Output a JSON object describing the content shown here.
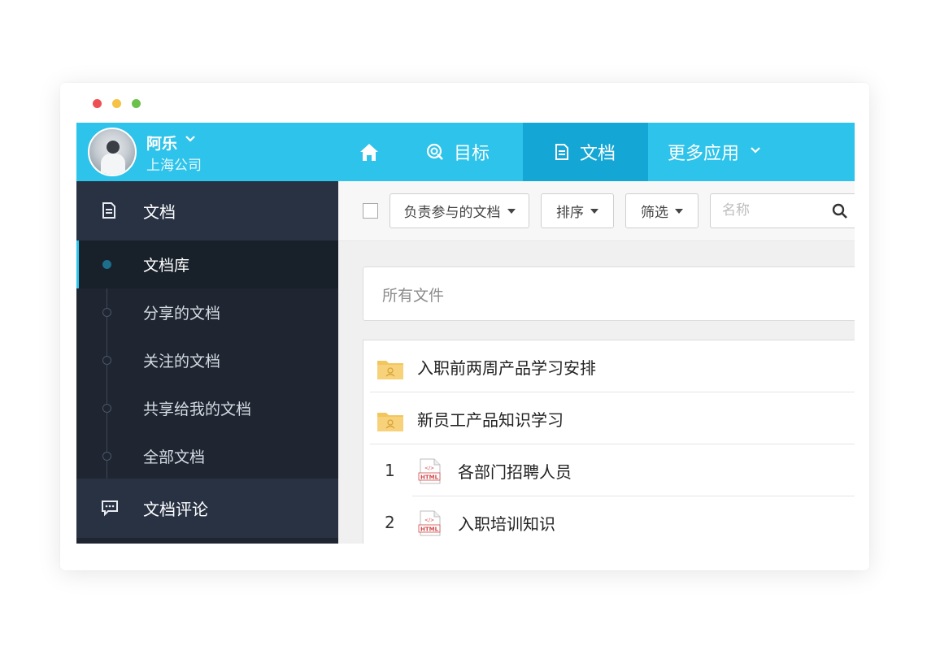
{
  "user": {
    "name": "阿乐",
    "company": "上海公司"
  },
  "topnav": {
    "home_icon": "home-icon",
    "items": [
      {
        "label": "目标",
        "icon": "target-icon"
      },
      {
        "label": "文档",
        "icon": "document-icon",
        "active": true
      },
      {
        "label": "更多应用",
        "icon": "chevron-down-icon"
      }
    ]
  },
  "sidebar": {
    "section_docs": "文档",
    "items": [
      {
        "label": "文档库",
        "active": true
      },
      {
        "label": "分享的文档"
      },
      {
        "label": "关注的文档"
      },
      {
        "label": "共享给我的文档"
      },
      {
        "label": "全部文档"
      }
    ],
    "section_comments": "文档评论"
  },
  "toolbar": {
    "filter_responsible": "负责参与的文档",
    "sort": "排序",
    "filter": "筛选",
    "search_placeholder": "名称"
  },
  "main": {
    "path_label": "所有文件",
    "folders": [
      {
        "name": "入职前两周产品学习安排"
      },
      {
        "name": "新员工产品知识学习"
      }
    ],
    "files": [
      {
        "index": "1",
        "name": "各部门招聘人员",
        "type": "HTML"
      },
      {
        "index": "2",
        "name": "入职培训知识",
        "type": "HTML"
      }
    ]
  },
  "colors": {
    "accent": "#2ec3ea",
    "accent_dark": "#14a7d5",
    "sidebar": "#1f2632"
  }
}
